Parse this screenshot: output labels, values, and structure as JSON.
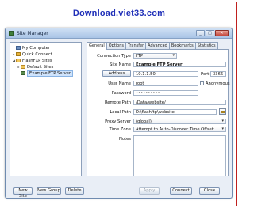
{
  "banner": "Download.viet33.com",
  "window": {
    "title": "Site Manager"
  },
  "tree": {
    "items": [
      {
        "label": "My Computer",
        "icon": "computer-icon",
        "expander": ""
      },
      {
        "label": "Quick Connect",
        "icon": "lightning-icon",
        "expander": "▸"
      },
      {
        "label": "FlashFXP Sites",
        "icon": "folder-icon",
        "expander": "◢"
      },
      {
        "label": "Default Sites",
        "icon": "folder-icon",
        "expander": "▸"
      },
      {
        "label": "Example FTP Server",
        "icon": "server-icon",
        "expander": "",
        "selected": true
      }
    ]
  },
  "tabs": [
    "General",
    "Options",
    "Transfer",
    "Advanced",
    "Bookmarks",
    "Statistics"
  ],
  "form": {
    "connection_type_label": "Connection Type",
    "connection_type_value": "FTP",
    "site_name_label": "Site Name",
    "site_name_value": "Example FTP Server",
    "address_button": "Address",
    "address_value": "10.1.1.50",
    "port_label": "Port",
    "port_value": "3366",
    "user_name_label": "User Name",
    "user_name_value": "root",
    "anonymous_label": "Anonymous",
    "password_label": "Password",
    "password_value": "••••••••••",
    "remote_path_label": "Remote Path",
    "remote_path_value": "/Data/website/",
    "local_path_label": "Local Path",
    "local_path_value": "D:\\flashftp\\website",
    "proxy_server_label": "Proxy Server",
    "proxy_server_value": "(global)",
    "time_zone_label": "Time Zone",
    "time_zone_value": "Attempt to Auto-Discover Time Offset",
    "notes_label": "Notes"
  },
  "buttons": {
    "new_site": "New Site",
    "new_group": "New Group",
    "delete": "Delete",
    "apply": "Apply",
    "connect": "Connect",
    "close": "Close"
  }
}
